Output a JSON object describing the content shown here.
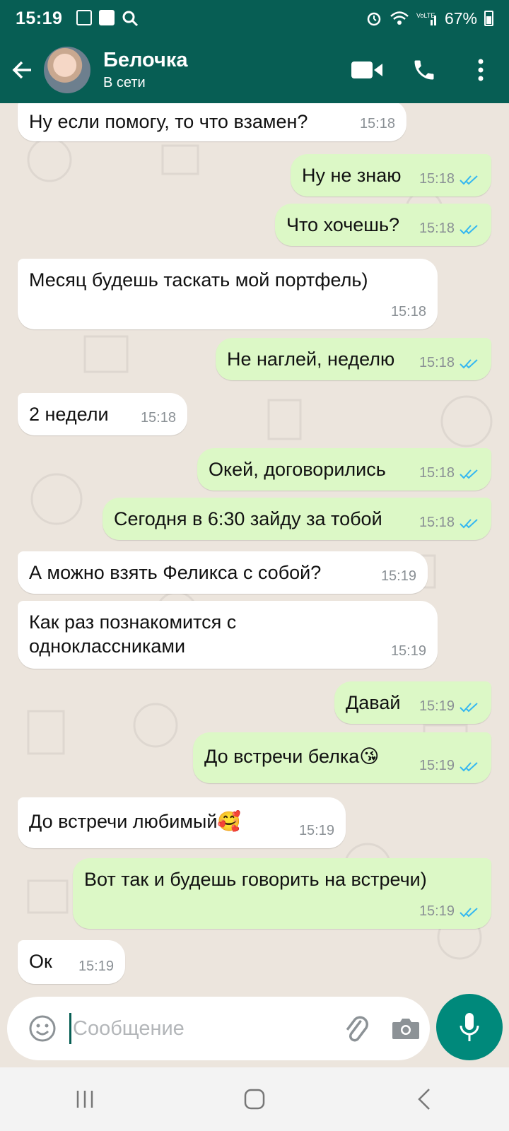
{
  "status_bar": {
    "time": "15:19",
    "battery": "67%"
  },
  "header": {
    "contact_name": "Белочка",
    "presence": "В сети"
  },
  "messages": [
    {
      "dir": "in",
      "text": "Ну если помогу, то что взамен?",
      "time": "15:18"
    },
    {
      "dir": "out",
      "text": "Ну не знаю",
      "time": "15:18",
      "read": true
    },
    {
      "dir": "out",
      "text": "Что хочешь?",
      "time": "15:18",
      "read": true
    },
    {
      "dir": "in",
      "text": "Месяц будешь таскать мой портфель)",
      "time": "15:18"
    },
    {
      "dir": "out",
      "text": "Не наглей, неделю",
      "time": "15:18",
      "read": true
    },
    {
      "dir": "in",
      "text": "2 недели",
      "time": "15:18"
    },
    {
      "dir": "out",
      "text": "Окей, договорились",
      "time": "15:18",
      "read": true
    },
    {
      "dir": "out",
      "text": "Сегодня в 6:30 зайду за тобой",
      "time": "15:18",
      "read": true
    },
    {
      "dir": "in",
      "text": "А можно взять Феликса с собой?",
      "time": "15:19"
    },
    {
      "dir": "in",
      "text": "Как раз познакомится с\nодноклассниками",
      "time": "15:19"
    },
    {
      "dir": "out",
      "text": "Давай",
      "time": "15:19",
      "read": true
    },
    {
      "dir": "out",
      "text": "До встречи белка😘",
      "time": "15:19",
      "read": true
    },
    {
      "dir": "in",
      "text": "До встречи любимый🥰",
      "time": "15:19"
    },
    {
      "dir": "out",
      "text": "Вот так и будешь говорить на встречи)",
      "time": "15:19",
      "read": true
    },
    {
      "dir": "in",
      "text": "Ок",
      "time": "15:19"
    }
  ],
  "composer": {
    "placeholder": "Сообщение"
  },
  "colors": {
    "header": "#075e54",
    "outgoing_bubble": "#dcf8c6",
    "incoming_bubble": "#ffffff",
    "read_ticks": "#34b7f1",
    "mic_button": "#00897b"
  }
}
